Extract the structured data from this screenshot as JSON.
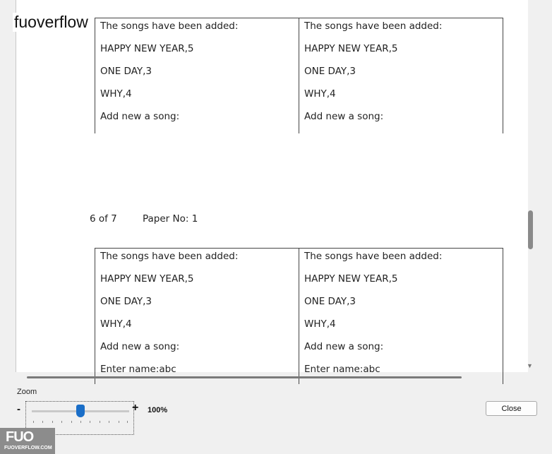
{
  "brand": {
    "label": "fuoverflow",
    "logo_mark": "FUO",
    "logo_domain": "FUOVERFLOW.COM"
  },
  "document": {
    "page_indicator": "6 of 7",
    "paper_number": "Paper No: 1",
    "top_table": {
      "left": [
        "The songs have been added:",
        "HAPPY NEW YEAR,5",
        "ONE DAY,3",
        "WHY,4",
        "Add new a song:"
      ],
      "right": [
        "The songs have been added:",
        "HAPPY NEW YEAR,5",
        "ONE DAY,3",
        "WHY,4",
        "Add new a song:"
      ]
    },
    "bottom_table": {
      "left": [
        "The songs have been added:",
        "HAPPY NEW YEAR,5",
        "ONE DAY,3",
        "WHY,4",
        "Add new a song:",
        "Enter name:abc"
      ],
      "right": [
        "The songs have been added:",
        "HAPPY NEW YEAR,5",
        "ONE DAY,3",
        "WHY,4",
        "Add new a song:",
        "Enter name:abc"
      ]
    }
  },
  "zoom": {
    "label": "Zoom",
    "minus": "-",
    "plus": "+",
    "value_text": "100%",
    "level": 0.5
  },
  "actions": {
    "close_label": "Close"
  },
  "colors": {
    "slider_thumb": "#1a6ec8",
    "page_background": "#ffffff",
    "window_background": "#f0f0f0"
  }
}
